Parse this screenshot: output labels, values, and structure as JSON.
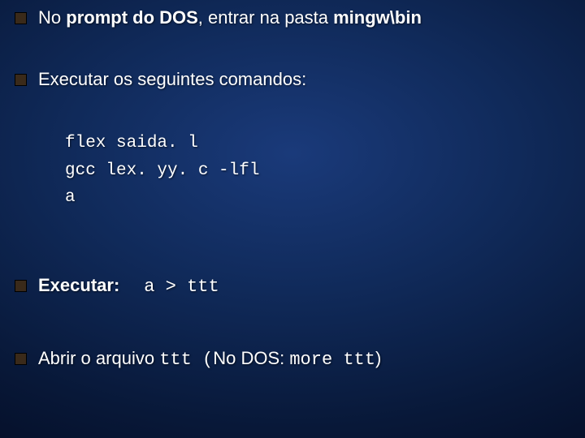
{
  "item1": {
    "pre": "No ",
    "b1": "prompt do DOS",
    "mid": ", entrar na pasta ",
    "b2": "mingw\\bin"
  },
  "item2": "Executar os seguintes comandos:",
  "code": "flex saida. l\ngcc lex. yy. c -lfl\na",
  "item3": {
    "label": "Executar:",
    "cmd": "a > ttt"
  },
  "item4": {
    "pre": "Abrir o arquivo ",
    "file": "ttt ",
    "open": "(",
    "mid": "No DOS: ",
    "cmd": "more ttt",
    "close": ")"
  }
}
